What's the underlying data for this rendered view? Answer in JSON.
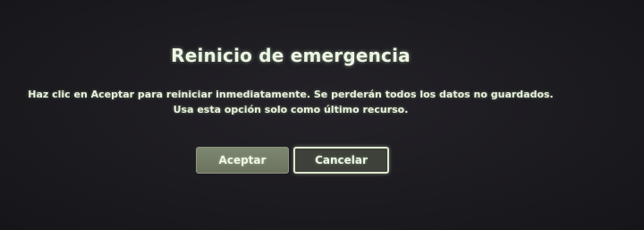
{
  "dialog": {
    "title": "Reinicio de emergencia",
    "message_line1": "Haz clic en Aceptar para reiniciar inmediatamente. Se perderán todos los datos no guardados.",
    "message_line2": "Usa esta opción solo como último recurso."
  },
  "buttons": {
    "accept_label": "Aceptar",
    "cancel_label": "Cancelar"
  },
  "colors": {
    "background": "#1b1a1f",
    "accept_button": "#747c67",
    "cancel_button": "#3e413a",
    "text": "#eaf2dc"
  }
}
